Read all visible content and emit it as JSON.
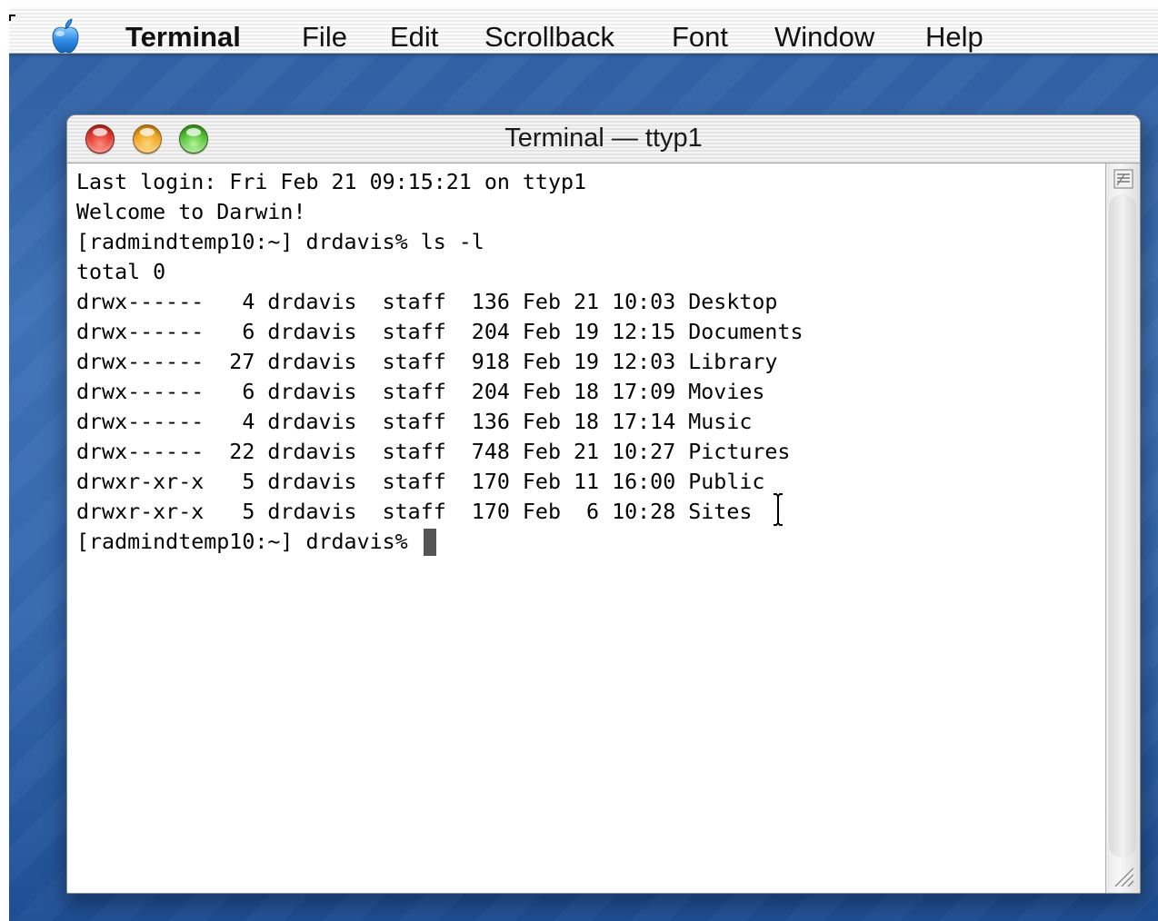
{
  "menubar": {
    "app_name": "Terminal",
    "items": [
      "File",
      "Edit",
      "Scrollback",
      "Font",
      "Window",
      "Help"
    ]
  },
  "window": {
    "title": "Terminal — ttyp1"
  },
  "terminal": {
    "lines": [
      "Last login: Fri Feb 21 09:15:21 on ttyp1",
      "Welcome to Darwin!",
      "[radmindtemp10:~] drdavis% ls -l",
      "total 0",
      "drwx------   4 drdavis  staff  136 Feb 21 10:03 Desktop",
      "drwx------   6 drdavis  staff  204 Feb 19 12:15 Documents",
      "drwx------  27 drdavis  staff  918 Feb 19 12:03 Library",
      "drwx------   6 drdavis  staff  204 Feb 18 17:09 Movies",
      "drwx------   4 drdavis  staff  136 Feb 18 17:14 Music",
      "drwx------  22 drdavis  staff  748 Feb 21 10:27 Pictures",
      "drwxr-xr-x   5 drdavis  staff  170 Feb 11 16:00 Public",
      "drwxr-xr-x   5 drdavis  staff  170 Feb  6 10:28 Sites"
    ],
    "prompt": "[radmindtemp10:~] drdavis% "
  },
  "colors": {
    "desktop": "#3467ae",
    "close": "#e0362a",
    "minimize": "#f0a21c",
    "zoom": "#4fbf30"
  },
  "icons": [
    "apple-logo-icon",
    "split-pane-icon",
    "resize-grip-icon",
    "ibeam-cursor-icon"
  ]
}
